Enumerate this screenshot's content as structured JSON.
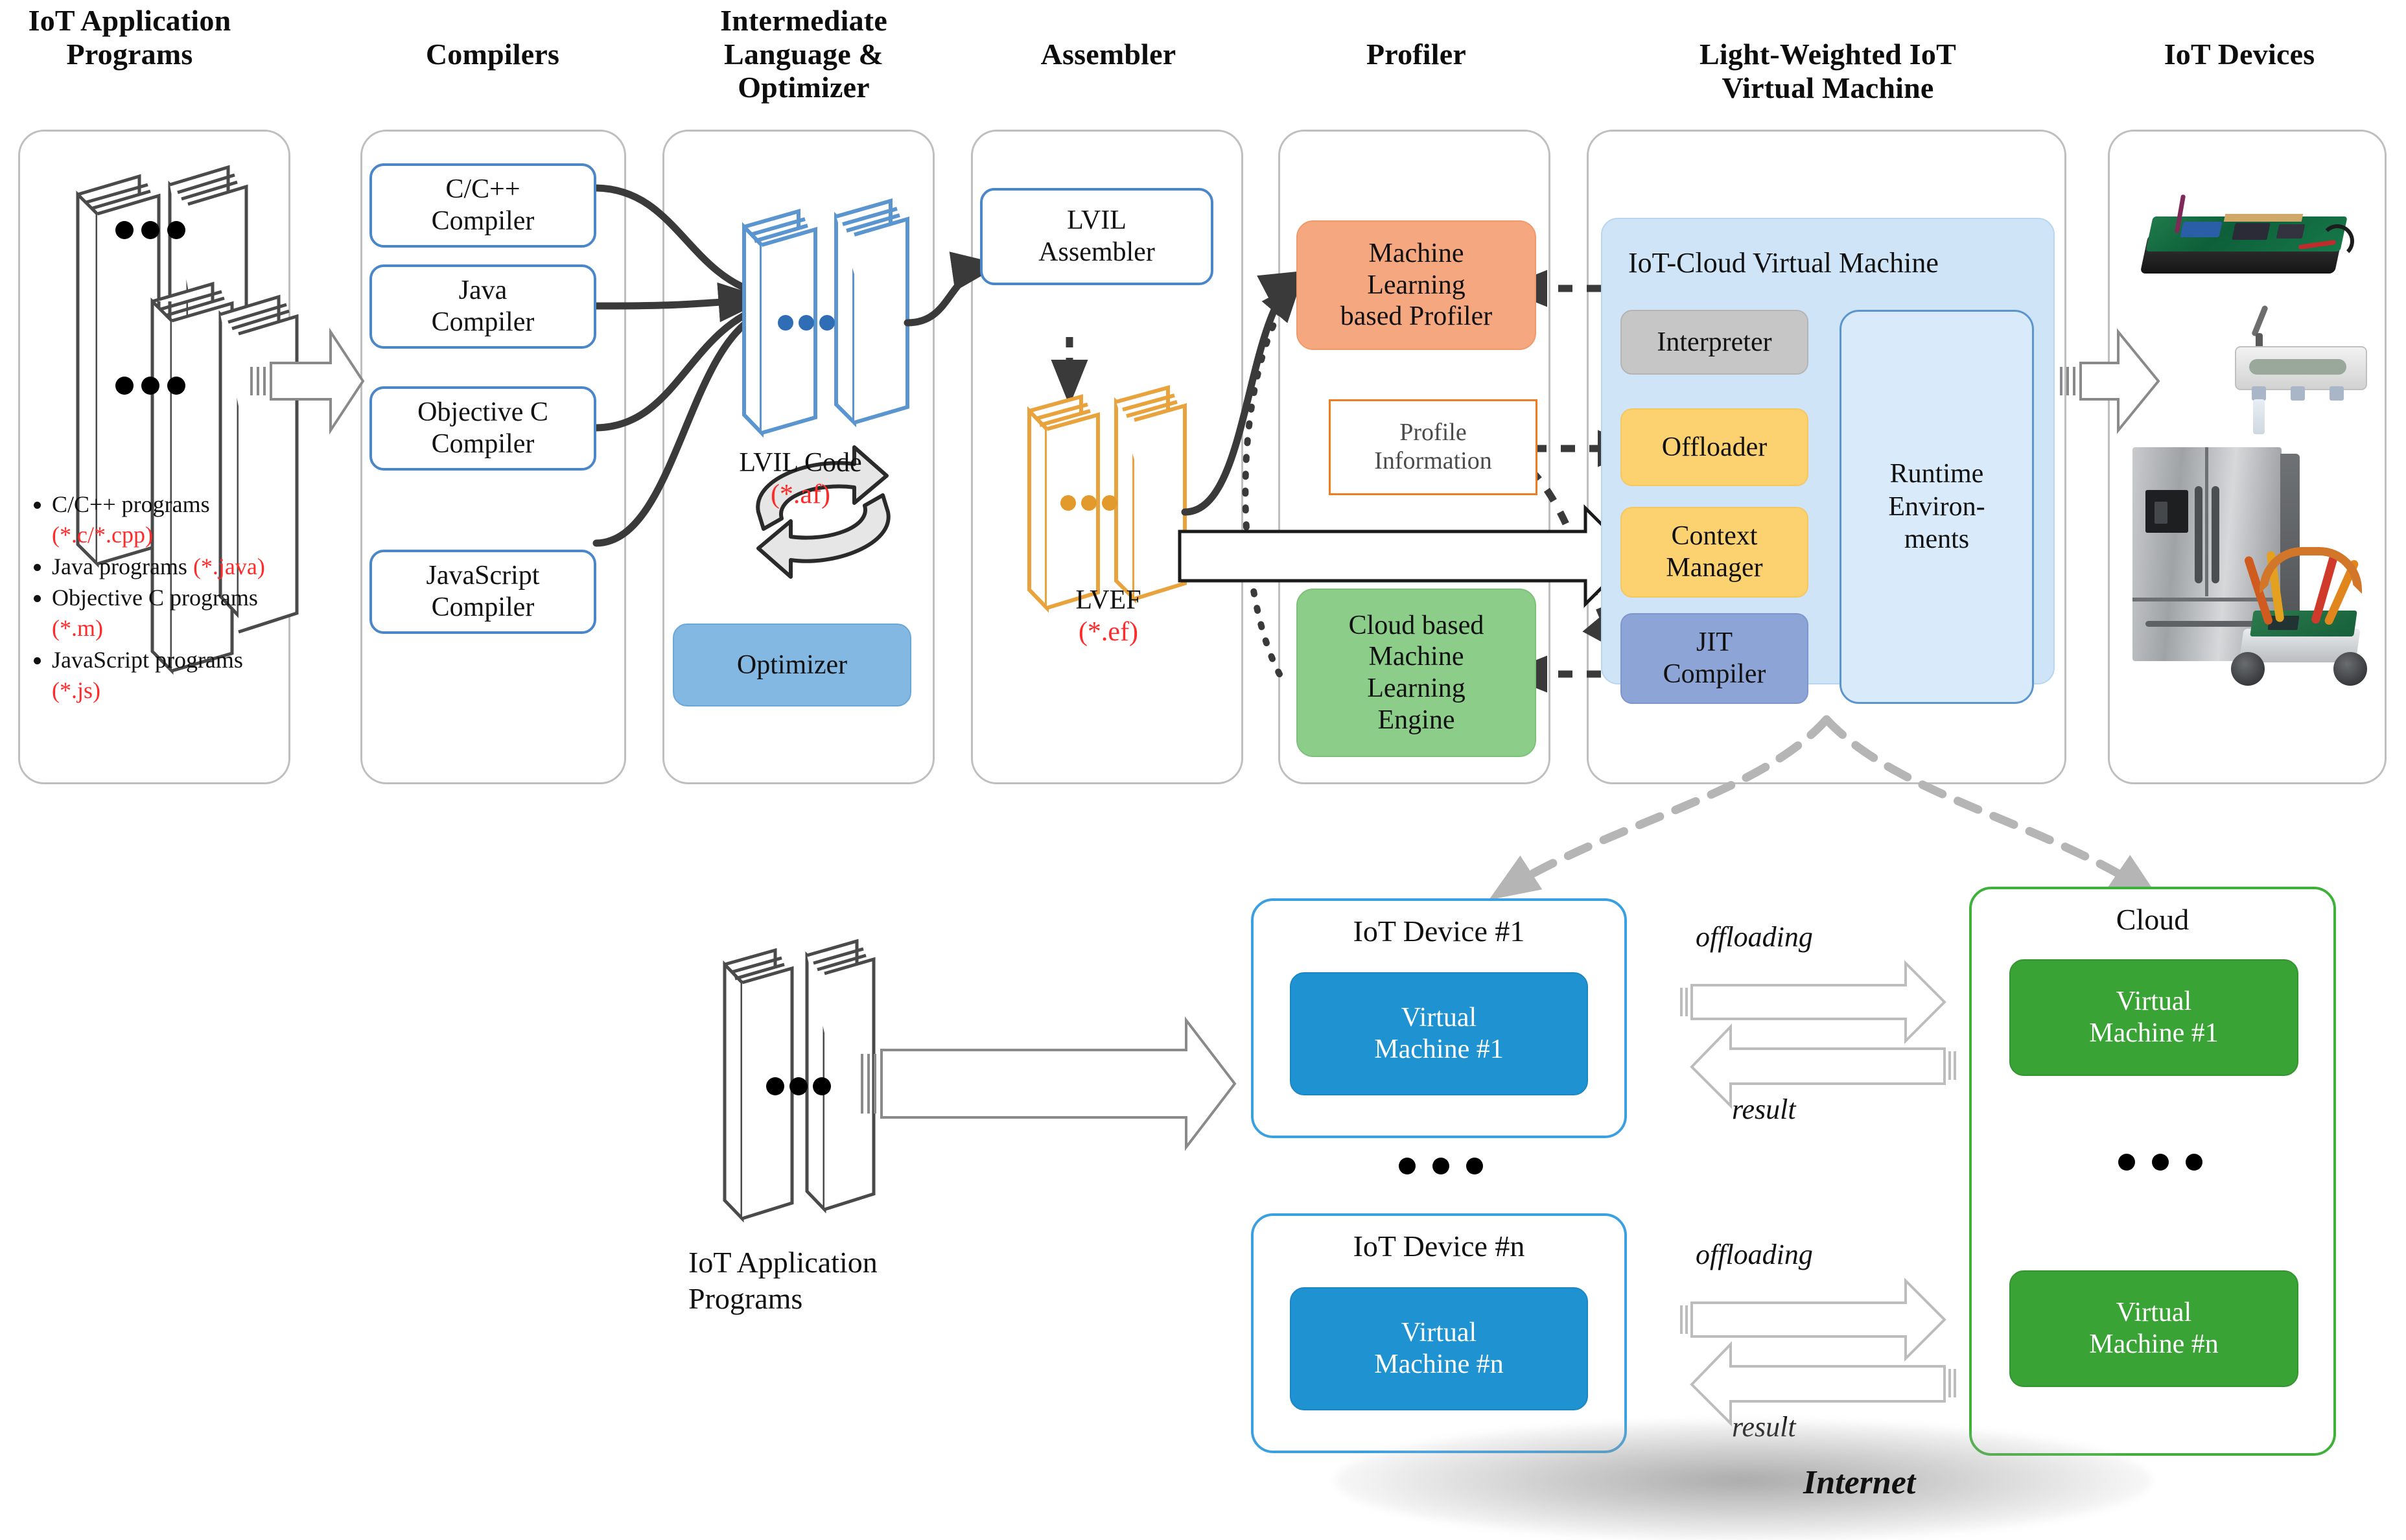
{
  "columns": [
    {
      "id": "apps",
      "title": "IoT Application\nPrograms"
    },
    {
      "id": "compilers",
      "title": "Compilers"
    },
    {
      "id": "il",
      "title": "Intermediate\nLanguage &\nOptimizer"
    },
    {
      "id": "assembler",
      "title": "Assembler"
    },
    {
      "id": "profiler",
      "title": "Profiler"
    },
    {
      "id": "lwvm",
      "title": "Light-Weighted IoT\nVirtual Machine"
    },
    {
      "id": "devices",
      "title": "IoT Devices"
    }
  ],
  "apps_panel": {
    "bullets": [
      {
        "text": "C/C++ programs ",
        "ext": "(*.c/*.cpp)"
      },
      {
        "text": "Java programs ",
        "ext": "(*.java)"
      },
      {
        "text": "Objective C programs ",
        "ext": "(*.m)"
      },
      {
        "text": "JavaScript programs ",
        "ext": "(*.js)"
      }
    ]
  },
  "compilers": [
    {
      "label": "C/C++\nCompiler"
    },
    {
      "label": "Java\nCompiler"
    },
    {
      "label": "Objective C\nCompiler"
    },
    {
      "label": "JavaScript\nCompiler"
    }
  ],
  "il_panel": {
    "code_caption": "LVIL Code",
    "code_ext": "(*.af)",
    "optimizer_label": "Optimizer"
  },
  "assembler_panel": {
    "assembler_label": "LVIL\nAssembler",
    "output_caption": "LVEF",
    "output_ext": "(*.ef)"
  },
  "profiler_panel": {
    "ml_profiler": "Machine\nLearning\nbased Profiler",
    "profile_info": "Profile\nInformation",
    "cloud_ml": "Cloud based\nMachine\nLearning\nEngine"
  },
  "lwvm_panel": {
    "vm_title": "IoT-Cloud Virtual Machine",
    "components": [
      {
        "label": "Interpreter",
        "style": "interp"
      },
      {
        "label": "Offloader",
        "style": "offl"
      },
      {
        "label": "Context\nManager",
        "style": "ctxm"
      },
      {
        "label": "JIT\nCompiler",
        "style": "jitc"
      }
    ],
    "runtime": "Runtime\nEnviron-\nments"
  },
  "devices_panel": {
    "items": [
      "single-board-computer-photo",
      "wireless-sensor-photo",
      "smart-refrigerator-photo",
      "robot-kit-photo"
    ]
  },
  "lower": {
    "stack_caption": "IoT Application\nPrograms",
    "devices": [
      {
        "title": "IoT Device #1",
        "vm": "Virtual\nMachine #1"
      },
      {
        "title": "IoT Device #n",
        "vm": "Virtual\nMachine #n"
      }
    ],
    "cloud": {
      "title": "Cloud",
      "vms": [
        {
          "label": "Virtual\nMachine #1"
        },
        {
          "label": "Virtual\nMachine #n"
        }
      ]
    },
    "flows": [
      {
        "label": "offloading",
        "dir": "right"
      },
      {
        "label": "result",
        "dir": "left"
      },
      {
        "label": "offloading",
        "dir": "right"
      },
      {
        "label": "result",
        "dir": "left"
      }
    ],
    "internet_label": "Internet"
  },
  "colors": {
    "panel_border": "#bfbfbf",
    "compiler_blue": "#4a86c8",
    "optimizer_blue": "#83b8e3",
    "profiler_orange": "#f5a77f",
    "note_orange": "#f07c22",
    "cloud_green": "#8dcd8a",
    "vm_shell_blue": "#cfe4f7",
    "interpreter_gray": "#c6c6c6",
    "offloader_yellow": "#fcd271",
    "jit_blue": "#8da4d6",
    "device_blue": "#1f93d2",
    "cloud_vm_green": "#3aa335",
    "red_ext": "#ff2a2a",
    "doc_blue": "#5b95cf",
    "doc_orange": "#e8a33d"
  }
}
